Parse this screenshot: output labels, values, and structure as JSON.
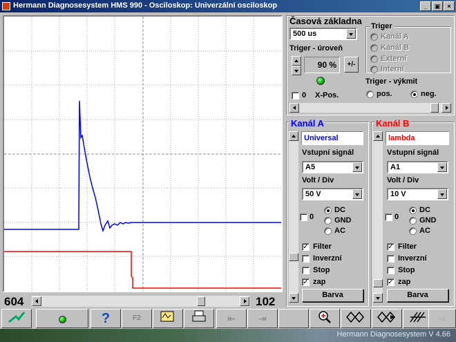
{
  "window": {
    "title": "Hermann Diagnosesystem HMS 990 - Osciloskop: Univerzální osciloskop"
  },
  "time_base": {
    "header": "Časová základna",
    "timebase_value": "500 us",
    "trigger_level_label": "Triger - úroveň",
    "trigger_level_value": "90 %",
    "plus_minus_label": "+/-",
    "xpos_value": "0",
    "xpos_label": "X-Pos."
  },
  "trigger": {
    "header": "Triger",
    "sources": [
      "Kanál A",
      "Kanál B",
      "Externí",
      "Interní"
    ],
    "slope_header": "Triger - výkmit",
    "slope_pos": "pos.",
    "slope_neg": "neg."
  },
  "channel_a": {
    "header": "Kanál A",
    "name_value": "Universal",
    "input_label": "Vstupní signál",
    "input_value": "A5",
    "volt_label": "Volt / Div",
    "volt_value": "50 V",
    "offset_value": "0",
    "coupling": [
      "DC",
      "GND",
      "AC"
    ],
    "checks": [
      "Filter",
      "Inverzní",
      "Stop",
      "zap"
    ],
    "color_button": "Barva",
    "color": "#0000ff"
  },
  "channel_b": {
    "header": "Kanál B",
    "name_value": "lambda",
    "input_label": "Vstupní signál",
    "input_value": "A1",
    "volt_label": "Volt / Div",
    "volt_value": "10 V",
    "offset_value": "0",
    "coupling": [
      "DC",
      "GND",
      "AC"
    ],
    "checks": [
      "Filter",
      "Inverzní",
      "Stop",
      "zap"
    ],
    "color_button": "Barva",
    "color": "#ff0000"
  },
  "scope": {
    "left_readout": "604",
    "right_readout": "102"
  },
  "toolbar": {
    "f2_label": "F2",
    "icons": [
      "probe-icon",
      "status-led-icon",
      "help-icon",
      "f2-icon",
      "scope-settings-icon",
      "print-icon",
      "cursor-left-icon",
      "cursor-right-icon",
      "blank-icon",
      "zoom-icon",
      "wave-left-icon",
      "wave-right-icon",
      "wave-hatch-icon",
      "arrow-right-icon"
    ]
  },
  "taskbar": {
    "status": "Hermann Diagnosesystem V 4.66"
  }
}
